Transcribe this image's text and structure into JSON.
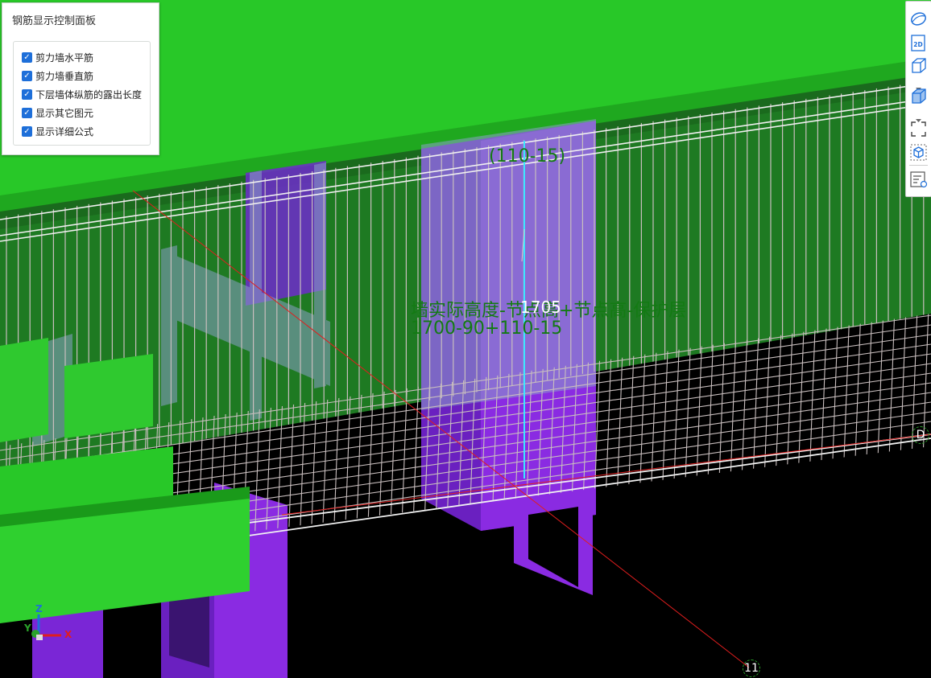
{
  "panel": {
    "title": "钢筋显示控制面板",
    "options": [
      {
        "label": "剪力墙水平筋",
        "checked": true
      },
      {
        "label": "剪力墙垂直筋",
        "checked": true
      },
      {
        "label": "下层墙体纵筋的露出长度",
        "checked": true
      },
      {
        "label": "显示其它图元",
        "checked": true
      },
      {
        "label": "显示详细公式",
        "checked": true
      }
    ]
  },
  "toolbar": {
    "buttons": [
      "orbit-icon",
      "2d-view-icon",
      "3d-box-icon",
      "3d-solid-box-icon",
      "fullscreen-icon",
      "3d-select-icon",
      "list-view-icon"
    ],
    "two_d_label": "2D"
  },
  "annotations": {
    "top_formula": "(110-15)",
    "length_value": "1705",
    "formula_text": "墙实际高度-节点高+节点高-保护层",
    "formula_numbers": "1700-90+110-15"
  },
  "axis_labels": {
    "grid_d": "D",
    "grid_11": "11"
  },
  "triad": {
    "z": "Z",
    "y": "Y",
    "x": "X"
  },
  "colors": {
    "slab_green": "#28c828",
    "wall_green": "#1e7a22",
    "column_purple": "#7a24d8",
    "rebar": "#c8bebe",
    "background": "#000000"
  }
}
